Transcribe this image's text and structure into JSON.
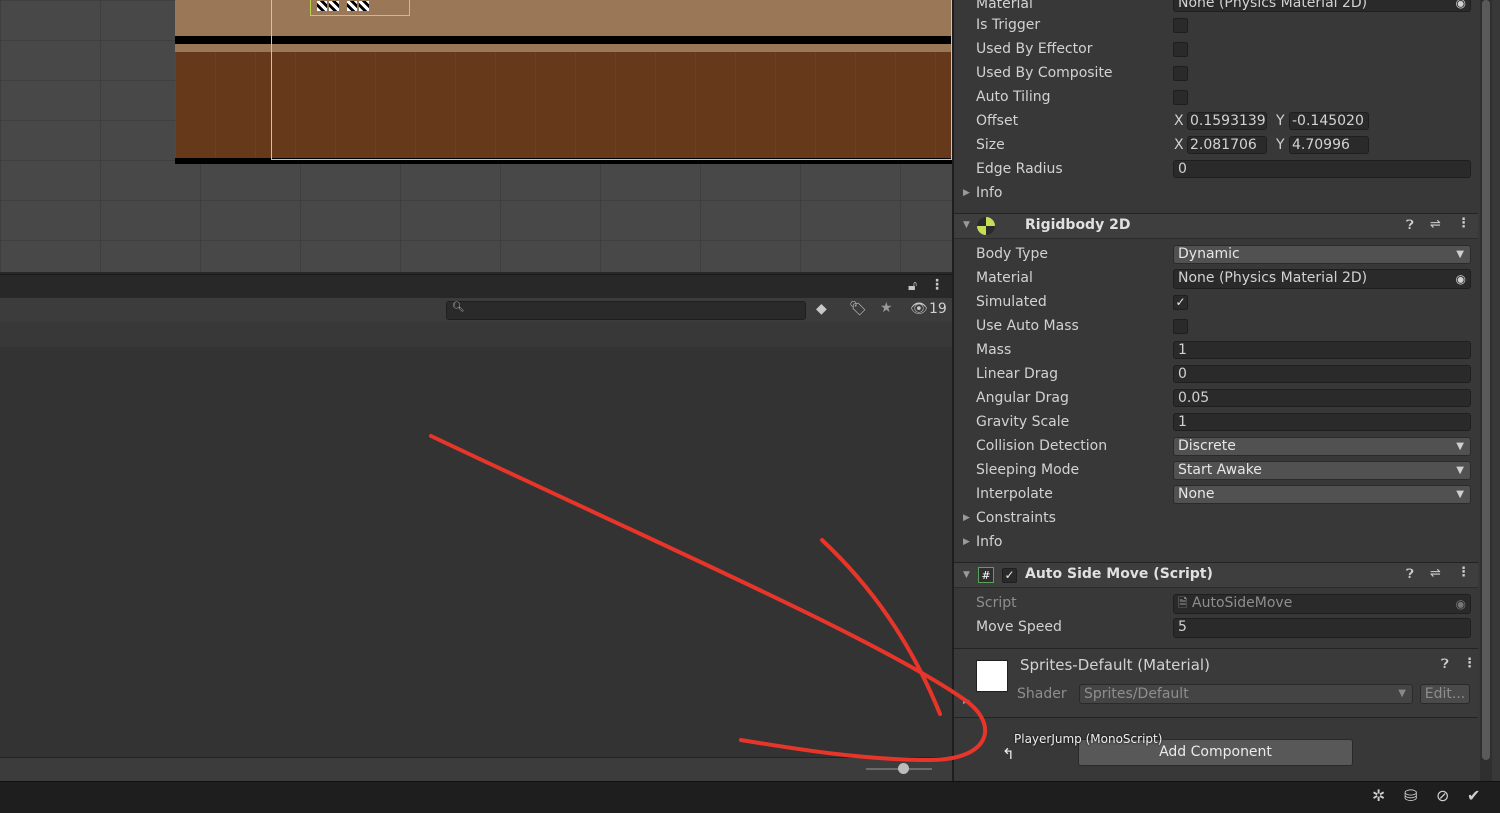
{
  "colors": {
    "annotation": "#e8352a",
    "scene_bg": "#484848",
    "inspector_bg": "#383838",
    "dirt": "#66391b",
    "sand": "#9a7756"
  },
  "project": {
    "hidden_count": "19",
    "icons": {
      "lock": "lock-icon",
      "more": "more-icon",
      "search": "search-icon",
      "filter": "filter-type-icon",
      "label": "label-icon",
      "favorite": "star-icon",
      "hidden": "eye-slash-icon"
    }
  },
  "inspector": {
    "collider": {
      "material_label": "Material",
      "material_value": "None (Physics Material 2D)",
      "is_trigger": "Is Trigger",
      "used_by_effector": "Used By Effector",
      "used_by_composite": "Used By Composite",
      "auto_tiling": "Auto Tiling",
      "offset_label": "Offset",
      "offset_x": "0.1593139",
      "offset_y": "-0.145020",
      "size_label": "Size",
      "size_x": "2.081706",
      "size_y": "4.70996",
      "edge_radius_label": "Edge Radius",
      "edge_radius": "0",
      "info": "Info",
      "x": "X",
      "y": "Y"
    },
    "rigidbody": {
      "title": "Rigidbody 2D",
      "body_type_label": "Body Type",
      "body_type": "Dynamic",
      "material_label": "Material",
      "material_value": "None (Physics Material 2D)",
      "simulated_label": "Simulated",
      "simulated_check": "✓",
      "use_auto_mass": "Use Auto Mass",
      "mass_label": "Mass",
      "mass": "1",
      "linear_drag_label": "Linear Drag",
      "linear_drag": "0",
      "angular_drag_label": "Angular Drag",
      "angular_drag": "0.05",
      "gravity_scale_label": "Gravity Scale",
      "gravity_scale": "1",
      "collision_detection_label": "Collision Detection",
      "collision_detection": "Discrete",
      "sleeping_mode_label": "Sleeping Mode",
      "sleeping_mode": "Start Awake",
      "interpolate_label": "Interpolate",
      "interpolate": "None",
      "constraints": "Constraints",
      "info": "Info"
    },
    "script": {
      "title": "Auto Side Move (Script)",
      "enabled_check": "✓",
      "script_label": "Script",
      "script_value": "AutoSideMove",
      "move_speed_label": "Move Speed",
      "move_speed": "5"
    },
    "material": {
      "title": "Sprites-Default (Material)",
      "shader_label": "Shader",
      "shader_value": "Sprites/Default",
      "edit_label": "Edit..."
    },
    "add_component": "Add Component",
    "drag_tooltip": "PlayerJump (MonoScript)"
  }
}
